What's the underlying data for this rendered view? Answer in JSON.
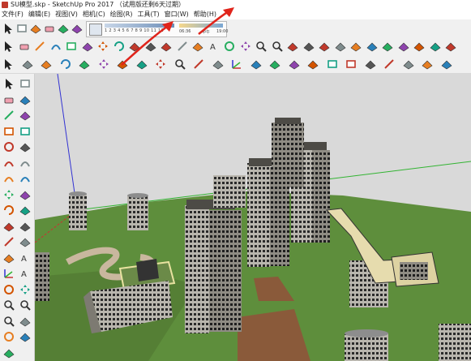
{
  "window": {
    "title": "SU模型.skp - SketchUp Pro 2017 （试用版还剩6天过期）"
  },
  "menu": [
    "文件(F)",
    "编辑(E)",
    "视图(V)",
    "相机(C)",
    "绘图(R)",
    "工具(T)",
    "窗口(W)",
    "帮助(H)"
  ],
  "shadow_panel": {
    "months": "1 2 3 4 5 6 7 8 9 10 11 12",
    "time_start": "06:36",
    "time_mid": "中午",
    "time_end": "19:00"
  },
  "colors": {
    "sky": "#d7d7d7",
    "ground": "#5e8e3c",
    "axis_red": "#c83232",
    "axis_green": "#32b432",
    "axis_blue": "#3232d2",
    "annotation_arrow": "#e0241b"
  },
  "icons": {
    "toolbar_row1": [
      "select-arrow-icon",
      "component-icon",
      "paint-bucket-icon",
      "eraser-icon",
      "styles-icon",
      "shadow-settings-icon",
      "pencil-line-icon",
      "arc-icon",
      "shapes-icon",
      "push-pull-icon",
      "move-icon",
      "rotate-icon",
      "scale-icon",
      "follow-me-icon",
      "offset-icon",
      "tape-measure-icon",
      "dimension-icon",
      "protractor-icon",
      "text-icon",
      "axes-icon",
      "3d-text-icon",
      "orbit-icon",
      "pan-icon",
      "zoom-icon",
      "zoom-window-icon",
      "zoom-extents-icon",
      "previous-view-icon",
      "next-view-icon",
      "position-camera-icon",
      "walk-icon",
      "look-around-icon",
      "section-plane-icon",
      "section-display-icon",
      "geo-location-icon",
      "photo-texture-icon"
    ],
    "toolbar_row2": [
      "select-arrow-icon",
      "eraser-icon",
      "pencil-line-icon",
      "arc-dropdown-icon",
      "rectangle-dropdown-icon",
      "push-pull-icon",
      "move-icon",
      "rotate-icon",
      "scale-icon",
      "offset-icon",
      "follow-me-icon",
      "tape-measure-icon",
      "dimension-icon",
      "text-icon",
      "orbit-icon",
      "pan-icon",
      "zoom-icon",
      "zoom-extents-icon",
      "solid-union-icon",
      "solid-subtract-icon",
      "solid-trim-icon",
      "solid-split-icon",
      "sandbox-from-contours-icon",
      "sandbox-from-scratch-icon",
      "smoove-icon",
      "stamp-icon",
      "drape-icon",
      "add-detail-icon",
      "flip-edge-icon"
    ],
    "toolbar_row3": [
      "select-arrow-icon",
      "push-pull-icon",
      "follow-me-icon",
      "rotate-icon",
      "offset-icon",
      "move-icon",
      "paint-bucket-icon",
      "walk-icon",
      "pan-icon",
      "zoom-icon",
      "tape-measure-icon",
      "scale-icon",
      "axes-icon",
      "section-plane-icon",
      "protractor-icon",
      "3d-warehouse-icon",
      "extension-warehouse-icon",
      "layout-icon",
      "components-icon",
      "entity-info-icon",
      "outliner-icon",
      "fog-icon",
      "match-photo-icon",
      "soften-edges-icon"
    ],
    "left_toolbar": [
      "select-arrow-icon",
      "make-component-icon",
      "eraser-icon",
      "paint-bucket-icon",
      "line-icon",
      "freehand-icon",
      "rectangle-icon",
      "rotated-rectangle-icon",
      "circle-icon",
      "polygon-icon",
      "arc-icon",
      "two-point-arc-icon",
      "three-point-arc-icon",
      "pie-icon",
      "move-icon",
      "push-pull-icon",
      "rotate-icon",
      "follow-me-icon",
      "scale-icon",
      "offset-icon",
      "tape-measure-icon",
      "dimension-icon",
      "protractor-icon",
      "text-icon",
      "axes-icon",
      "3d-text-icon",
      "orbit-icon",
      "pan-icon",
      "zoom-icon",
      "zoom-window-icon",
      "zoom-extents-icon",
      "position-camera-icon",
      "look-around-icon",
      "walk-icon",
      "section-plane-icon"
    ]
  }
}
